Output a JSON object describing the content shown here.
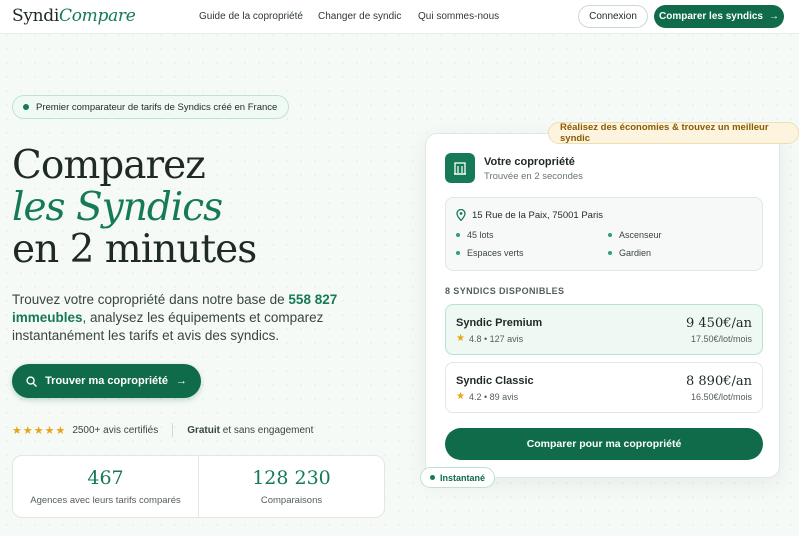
{
  "brand": {
    "part1": "Syndi",
    "part2": "Compare"
  },
  "nav": {
    "links": [
      "Guide de la copropriété",
      "Changer de syndic",
      "Qui sommes-nous"
    ],
    "login": "Connexion",
    "compare": "Comparer les syndics"
  },
  "hero": {
    "pill": "Premier comparateur de tarifs de Syndics créé en France",
    "line1": "Comparez",
    "line2": "les Syndics",
    "line3": "en 2 minutes",
    "lead_pre": "Trouvez votre copropriété dans notre base de ",
    "lead_highlight": "558 827 immeubles",
    "lead_post": ", analysez les équipements et comparez instantanément les tarifs et avis des syndics.",
    "cta": "Trouver ma copropriété",
    "reviews": "2500+ avis certifiés",
    "free_bold": "Gratuit",
    "free_rest": " et sans engagement",
    "stars": "★★★★★"
  },
  "stats": [
    {
      "value": "467",
      "label": "Agences avec leurs tarifs comparés"
    },
    {
      "value": "128 230",
      "label": "Comparaisons"
    }
  ],
  "card": {
    "badge_top": "Réalisez des économies & trouvez un meilleur syndic",
    "badge_bottom": "Instantané",
    "title": "Votre copropriété",
    "subtitle": "Trouvée en 2 secondes",
    "address": "15 Rue de la Paix, 75001 Paris",
    "features": [
      "45 lots",
      "Ascenseur",
      "Espaces verts",
      "Gardien"
    ],
    "section": "8 SYNDICS DISPONIBLES",
    "offers": [
      {
        "name": "Syndic Premium",
        "rating": "4.8 • 127 avis",
        "price": "9 450€/an",
        "unit": "17.50€/lot/mois"
      },
      {
        "name": "Syndic Classic",
        "rating": "4.2 • 89 avis",
        "price": "8 890€/an",
        "unit": "16.50€/lot/mois"
      }
    ],
    "button": "Comparer pour ma copropriété"
  },
  "icons": {
    "arrow": "arrow-right-icon",
    "search": "search-icon",
    "pin": "map-pin-icon",
    "building": "building-icon",
    "star": "star-icon"
  },
  "colors": {
    "brand_green": "#157a55",
    "button_green": "#0f6b4a",
    "star": "#e8a317",
    "highlight_bg": "#fdf4df"
  }
}
